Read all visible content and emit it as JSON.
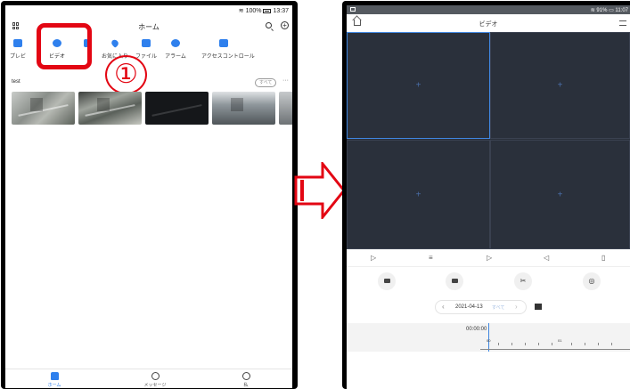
{
  "left_screen": {
    "status": {
      "battery": "100%",
      "time": "13:37"
    },
    "header": {
      "title": "ホーム"
    },
    "menu": [
      {
        "label": "プレビ",
        "icon": "camera-icon"
      },
      {
        "label": "ビデオ",
        "icon": "video-icon"
      },
      {
        "label": "",
        "icon": "partial-icon"
      },
      {
        "label": "お気に入り",
        "icon": "heart-icon"
      },
      {
        "label": "ファイル",
        "icon": "folder-icon"
      },
      {
        "label": "アラーム",
        "icon": "alarm-icon"
      },
      {
        "label": "アクセスコントロール",
        "icon": "door-icon"
      }
    ],
    "annotation": {
      "step": "①"
    },
    "group": {
      "name": "test",
      "all_label": "すべて",
      "more_label": "···"
    },
    "tabs": [
      {
        "label": "ホーム",
        "icon": "home-icon"
      },
      {
        "label": "メッセージ",
        "icon": "message-icon"
      },
      {
        "label": "私",
        "icon": "user-icon"
      }
    ]
  },
  "right_screen": {
    "status": {
      "battery": "91%",
      "time": "11:07"
    },
    "header": {
      "title": "ビデオ"
    },
    "cells": [
      "+",
      "+",
      "+",
      "+"
    ],
    "controls": [
      "▷",
      "≡",
      "▷",
      "◁",
      "▯"
    ],
    "date_bar": {
      "prev": "‹",
      "date": "2021-04-13",
      "all": "すべて",
      "next": "›"
    },
    "timeline": {
      "time": "00:00:00",
      "label_00": "00",
      "label_01": "01"
    }
  },
  "colors": {
    "accent": "#2f80ed",
    "highlight": "#e30613",
    "video_bg": "#2a303b"
  }
}
